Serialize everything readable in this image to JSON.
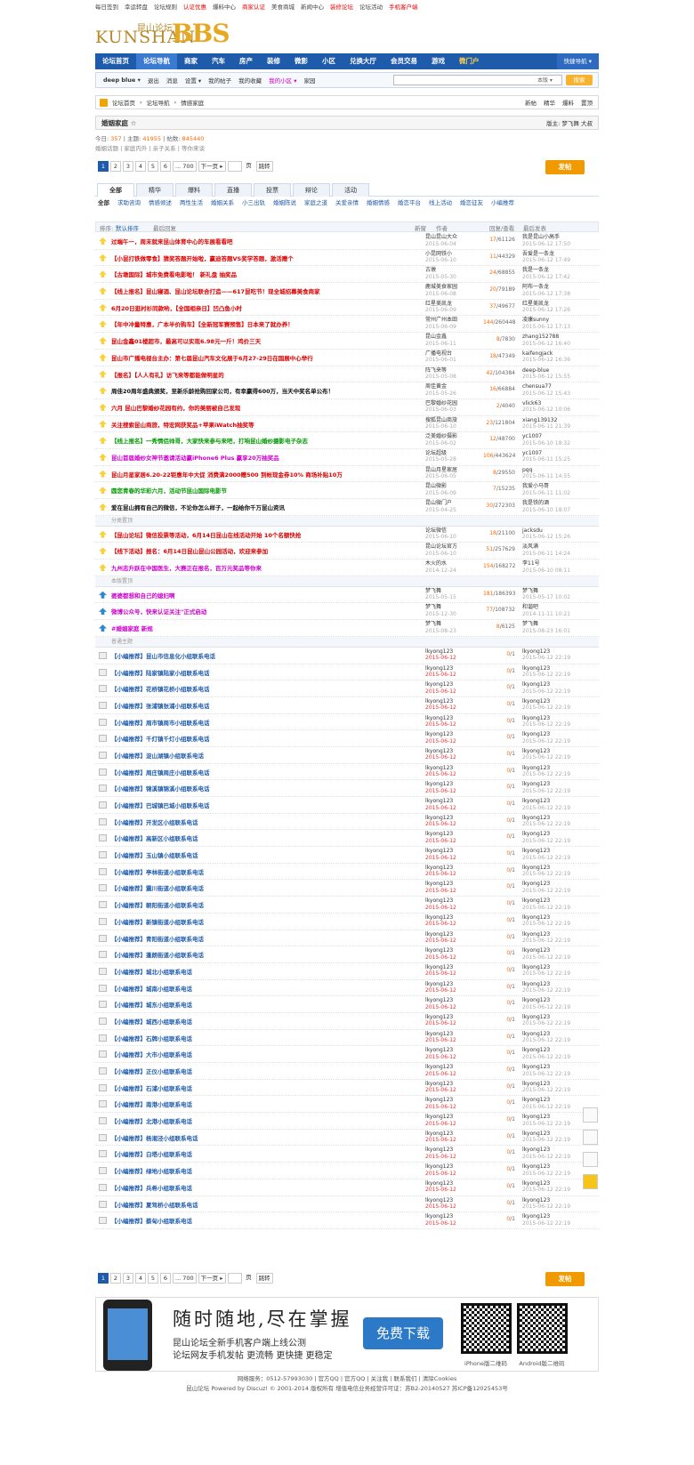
{
  "topbar": [
    "每日签到",
    "幸运转盘",
    "论坛规则",
    "认证优惠",
    "爆料中心",
    "商家认证",
    "美食商城",
    "新闻中心",
    "装修论坛",
    "论坛活动",
    "手机客户端"
  ],
  "logo": {
    "cn": "昆山论坛",
    "en": "KUNSHAN",
    "bbs": "BBS"
  },
  "nav": [
    "论坛首页",
    "论坛导航",
    "商家",
    "汽车",
    "房产",
    "装修",
    "微影",
    "小区",
    "兑换大厅",
    "会员交易",
    "游戏",
    "微门户"
  ],
  "nav_quick": "快捷导航 ▾",
  "subnav": [
    "deep blue ▾",
    "退出",
    "消息",
    "设置 ▾",
    "我的帖子",
    "我的收藏",
    "我的小区 ▾",
    "家园"
  ],
  "search_scope": "本版 ▾",
  "search_btn": "搜索",
  "crumb": [
    "论坛首页",
    "论坛导航",
    "情感家庭"
  ],
  "crumb_right": [
    "新帖",
    "精华",
    "爆料",
    "置顶"
  ],
  "forum": {
    "title": "婚姻家庭 ☆",
    "moderator": "版主: 梦飞舞 大叔"
  },
  "stats": {
    "today_l": "今日:",
    "today": "357",
    "topics_l": "主题:",
    "topics": "41955",
    "posts_l": "| 帖数:",
    "posts": "845440"
  },
  "stats2": "婚姻话题 | 家庭内外 | 亲子关系 | 等你来谈",
  "pages": [
    "1",
    "2",
    "3",
    "4",
    "5",
    "6",
    "... 700",
    "下一页 ▸"
  ],
  "pager_jump": "页",
  "pager_go": "跳转",
  "post_btn": "发帖",
  "tabs": [
    "全部",
    "精华",
    "爆料",
    "直播",
    "投票",
    "辩论",
    "活动"
  ],
  "filters": [
    "全部",
    "求助咨询",
    "情感倾述",
    "两性生活",
    "婚姻关系",
    "小三出轨",
    "婚姻陈说",
    "家庭之道",
    "关爱亲情",
    "婚姻情感",
    "婚恋平台",
    "线上活动",
    "婚恋征友",
    "小编推荐"
  ],
  "thead": {
    "sort": "排序:",
    "order1": "默认排序",
    "order2": "最后回复",
    "new": "新窗",
    "author": "作者",
    "reply": "回复/查看",
    "last": "最后发表"
  },
  "sec1": "分类置顶",
  "sec2": "本版置顶",
  "sec3": "普通主题",
  "rows": [
    {
      "title": "过端午一，周末就来昆山体育中心的车展看看吧",
      "color": "#d00",
      "author": "昆山昆山大众",
      "date": "2015-06-04",
      "reply": "17",
      "view": "61126",
      "last": "我是昆山小高手",
      "ldate": "2015-06-12 17:50"
    },
    {
      "title": "【小昆打铁做零食】猜奖答题开始啦，赢迪答题VS奖学答题，激活赠个",
      "color": "#d00",
      "author": "小昆网铁小",
      "date": "2015-06-10",
      "reply": "11",
      "view": "44329",
      "last": "吾爱是一条龙",
      "ldate": "2015-06-12 17:49"
    },
    {
      "title": "【古墩国际】城市免费看电影啦！ 新礼盘 抽奖品",
      "color": "#d00",
      "author": "古墩",
      "date": "2015-05-30",
      "reply": "24",
      "view": "68855",
      "last": "我是一条龙",
      "ldate": "2015-06-12 17:42"
    },
    {
      "title": "【线上报名】昆山寝酒、昆山论坛联合打造——617昆吃节！现全城招募美食商家",
      "color": "#d00",
      "author": "鹿城美食家园",
      "date": "2015-06-08",
      "reply": "20",
      "view": "79189",
      "last": "阿布一条龙",
      "ldate": "2015-06-12 17:38"
    },
    {
      "title": "6月20日逛衬衫同款哟，【全国相亲日】凹凸鱼小时",
      "color": "#d00",
      "author": "红星美凯龙",
      "date": "2015-06-09",
      "reply": "37",
      "view": "49677",
      "last": "红星美凯龙",
      "ldate": "2015-06-12 17:26"
    },
    {
      "title": "【年中冲量特惠，广本半价购车】【全新冠军赛预售】日本来了就办养！",
      "color": "#d00",
      "author": "常州广州本田",
      "date": "2015-06-09",
      "reply": "144",
      "view": "260448",
      "last": "凌康sunny",
      "ldate": "2015-06-12 17:13"
    },
    {
      "title": "昆山金鑫01楼超市，最高可以实现6.98元一斤！鸡价三天",
      "color": "#d00",
      "author": "昆山金鑫",
      "date": "2015-06-11",
      "reply": "8",
      "view": "7830",
      "last": "zhang152788",
      "ldate": "2015-06-12 16:40"
    },
    {
      "title": "昆山市广播电视台主办：第七届昆山汽车文化展于6月27-29日在国展中心举行",
      "color": "#d00",
      "author": "广播电视台",
      "date": "2015-06-01",
      "reply": "18",
      "view": "47349",
      "last": "kaifengjack",
      "ldate": "2015-06-12 16:36"
    },
    {
      "title": "【报名】【人人有礼】访飞来等都能做明星的",
      "color": "#d00",
      "author": "阵飞来等",
      "date": "2015-05-08",
      "reply": "42",
      "view": "104384",
      "last": "deep-blue",
      "ldate": "2015-06-12 15:55"
    },
    {
      "title": "周佳20周年盛典颁奖，至新乐龄抢购回家公司，有幸赢得600万，当天中奖名单公布！",
      "color": "#111",
      "author": "周佳黄金",
      "date": "2015-05-26",
      "reply": "16",
      "view": "66884",
      "last": "chensua77",
      "ldate": "2015-06-12 15:43"
    },
    {
      "title": "六月 昆山巴黎婚纱花园有约，你的美丽被自己发现",
      "color": "#d00",
      "author": "巴黎婚纱花园",
      "date": "2015-06-03",
      "reply": "2",
      "view": "4040",
      "last": "vlick63",
      "ldate": "2015-06-12 10:06"
    },
    {
      "title": "关注搜索昆山商旅，特宏网获奖品+苹果iWatch抽奖等",
      "color": "#d00",
      "author": "搜狐昆山商旅",
      "date": "2015-06-10",
      "reply": "23",
      "view": "121804",
      "last": "xiang139132",
      "ldate": "2015-06-11 21:39"
    },
    {
      "title": "【线上报名】一秀情侣帅哥，大家快来参与来吧，打响昆山婚纱摄影电子杂志",
      "color": "#090",
      "author": "泛美婚纱摄影",
      "date": "2015-06-02",
      "reply": "12",
      "view": "48700",
      "last": "yc1007",
      "ldate": "2015-06-10 18:32"
    },
    {
      "title": "昆山首届婚纱女神节邀请活动赢iPhone6 Plus 赢享20万抽奖品",
      "color": "#c0c",
      "author": "论坛超级",
      "date": "2015-05-28",
      "reply": "106",
      "view": "443624",
      "last": "yc1007",
      "ldate": "2015-06-11 15:25"
    },
    {
      "title": "昆山月星家居6.20-22钜惠年中大促 消费满2000赠500 到帐现金券10% 商场补贴10万",
      "color": "#d00",
      "author": "昆山月星家居",
      "date": "2015-06-05",
      "reply": "8",
      "view": "29550",
      "last": "pqq",
      "ldate": "2015-06-11 14:55"
    },
    {
      "title": "圆您青春的华彩六月，活动节昆山国际电影节",
      "color": "#090",
      "author": "昆山微影",
      "date": "2015-06-09",
      "reply": "7",
      "view": "15235",
      "last": "我爱小马哥",
      "ldate": "2015-06-11 11:02"
    },
    {
      "title": "爱在昆山拥有自己的微信，不论你怎么样子，一起给你千万昆山资讯",
      "color": "#111",
      "author": "昆山微门户",
      "date": "2015-04-25",
      "reply": "30",
      "view": "272303",
      "last": "我是铁的酒",
      "ldate": "2015-06-10 18:07"
    },
    {
      "sep": "sec1"
    },
    {
      "title": "【昆山论坛】微信投票等活动，6月14日昆山在线活动开始 10个名额快抢",
      "color": "#d00",
      "author": "论坛微信",
      "date": "2015-06-10",
      "reply": "18",
      "view": "21100",
      "last": "jacksdu",
      "ldate": "2015-06-12 15:26"
    },
    {
      "title": "【线下活动】报名：6月14日昆山昆山公园活动，欢迎来参加",
      "color": "#d00",
      "author": "昆山论坛官方",
      "date": "2015-06-10",
      "reply": "51",
      "view": "257629",
      "last": "淡风满",
      "ldate": "2015-06-11 14:24"
    },
    {
      "title": "九州志升跃在中国医生，大赛正在报名，百万元奖品等你来",
      "color": "#c0c",
      "author": "木火的水",
      "date": "2014-12-24",
      "reply": "154",
      "view": "168272",
      "last": "李11号",
      "ldate": "2015-06-10 08:11"
    },
    {
      "sep": "sec2"
    },
    {
      "title": "婆婆都想和自己的媳妇啊",
      "color": "#c0c",
      "author": "梦飞舞",
      "date": "2015-05-15",
      "reply": "181",
      "view": "186393",
      "last": "梦飞舞",
      "ldate": "2015-05-17 10:02"
    },
    {
      "title": "微博公众号，快来认证关注\"正式启动",
      "color": "#c0c",
      "author": "梦飞舞",
      "date": "2015-12-30",
      "reply": "77",
      "view": "108732",
      "last": "和谐吧",
      "ldate": "2014-11-11 10:21"
    },
    {
      "title": "#婚姻家庭 新规",
      "color": "#c0c",
      "author": "梦飞舞",
      "date": "2015-08-23",
      "reply": "8",
      "view": "6125",
      "last": "梦飞舞",
      "ldate": "2015-08-23 16:01"
    },
    {
      "sep": "sec3"
    },
    {
      "title": "【小编推荐】昆山市信息化小组联系电话",
      "color": "#1f5bab",
      "author": "lkyong123",
      "date": "2015-06-12",
      "reply": "0",
      "view": "1",
      "last": "lkyong123",
      "ldate": "2015-06-12 22:19"
    },
    {
      "title": "【小编推荐】陆家镇陆家小组联系电话",
      "color": "#1f5bab",
      "author": "lkyong123",
      "date": "2015-06-12",
      "reply": "0",
      "view": "1",
      "last": "lkyong123",
      "ldate": "2015-06-12 22:19"
    },
    {
      "title": "【小编推荐】花桥镇花桥小组联系电话",
      "color": "#1f5bab",
      "author": "lkyong123",
      "date": "2015-06-12",
      "reply": "0",
      "view": "1",
      "last": "lkyong123",
      "ldate": "2015-06-12 22:19"
    },
    {
      "title": "【小编推荐】张浦镇张浦小组联系电话",
      "color": "#1f5bab",
      "author": "lkyong123",
      "date": "2015-06-12",
      "reply": "0",
      "view": "1",
      "last": "lkyong123",
      "ldate": "2015-06-12 22:19"
    },
    {
      "title": "【小编推荐】周市镇周市小组联系电话",
      "color": "#1f5bab",
      "author": "lkyong123",
      "date": "2015-06-12",
      "reply": "0",
      "view": "1",
      "last": "lkyong123",
      "ldate": "2015-06-12 22:19"
    },
    {
      "title": "【小编推荐】千灯镇千灯小组联系电话",
      "color": "#1f5bab",
      "author": "lkyong123",
      "date": "2015-06-12",
      "reply": "0",
      "view": "1",
      "last": "lkyong123",
      "ldate": "2015-06-12 22:19"
    },
    {
      "title": "【小编推荐】淀山湖镇小组联系电话",
      "color": "#1f5bab",
      "author": "lkyong123",
      "date": "2015-06-12",
      "reply": "0",
      "view": "1",
      "last": "lkyong123",
      "ldate": "2015-06-12 22:19"
    },
    {
      "title": "【小编推荐】周庄镇周庄小组联系电话",
      "color": "#1f5bab",
      "author": "lkyong123",
      "date": "2015-06-12",
      "reply": "0",
      "view": "1",
      "last": "lkyong123",
      "ldate": "2015-06-12 22:19"
    },
    {
      "title": "【小编推荐】锦溪镇锦溪小组联系电话",
      "color": "#1f5bab",
      "author": "lkyong123",
      "date": "2015-06-12",
      "reply": "0",
      "view": "1",
      "last": "lkyong123",
      "ldate": "2015-06-12 22:19"
    },
    {
      "title": "【小编推荐】巴城镇巴城小组联系电话",
      "color": "#1f5bab",
      "author": "lkyong123",
      "date": "2015-06-12",
      "reply": "0",
      "view": "1",
      "last": "lkyong123",
      "ldate": "2015-06-12 22:19"
    },
    {
      "title": "【小编推荐】开发区小组联系电话",
      "color": "#1f5bab",
      "author": "lkyong123",
      "date": "2015-06-12",
      "reply": "0",
      "view": "1",
      "last": "lkyong123",
      "ldate": "2015-06-12 22:19"
    },
    {
      "title": "【小编推荐】高新区小组联系电话",
      "color": "#1f5bab",
      "author": "lkyong123",
      "date": "2015-06-12",
      "reply": "0",
      "view": "1",
      "last": "lkyong123",
      "ldate": "2015-06-12 22:19"
    },
    {
      "title": "【小编推荐】玉山镇小组联系电话",
      "color": "#1f5bab",
      "author": "lkyong123",
      "date": "2015-06-12",
      "reply": "0",
      "view": "1",
      "last": "lkyong123",
      "ldate": "2015-06-12 22:19"
    },
    {
      "title": "【小编推荐】亭林街道小组联系电话",
      "color": "#1f5bab",
      "author": "lkyong123",
      "date": "2015-06-12",
      "reply": "0",
      "view": "1",
      "last": "lkyong123",
      "ldate": "2015-06-12 22:19"
    },
    {
      "title": "【小编推荐】震川街道小组联系电话",
      "color": "#1f5bab",
      "author": "lkyong123",
      "date": "2015-06-12",
      "reply": "0",
      "view": "1",
      "last": "lkyong123",
      "ldate": "2015-06-12 22:19"
    },
    {
      "title": "【小编推荐】朝阳街道小组联系电话",
      "color": "#1f5bab",
      "author": "lkyong123",
      "date": "2015-06-12",
      "reply": "0",
      "view": "1",
      "last": "lkyong123",
      "ldate": "2015-06-12 22:19"
    },
    {
      "title": "【小编推荐】新镇街道小组联系电话",
      "color": "#1f5bab",
      "author": "lkyong123",
      "date": "2015-06-12",
      "reply": "0",
      "view": "1",
      "last": "lkyong123",
      "ldate": "2015-06-12 22:19"
    },
    {
      "title": "【小编推荐】青阳街道小组联系电话",
      "color": "#1f5bab",
      "author": "lkyong123",
      "date": "2015-06-12",
      "reply": "0",
      "view": "1",
      "last": "lkyong123",
      "ldate": "2015-06-12 22:19"
    },
    {
      "title": "【小编推荐】蓬朗街道小组联系电话",
      "color": "#1f5bab",
      "author": "lkyong123",
      "date": "2015-06-12",
      "reply": "0",
      "view": "1",
      "last": "lkyong123",
      "ldate": "2015-06-12 22:19"
    },
    {
      "title": "【小编推荐】城北小组联系电话",
      "color": "#1f5bab",
      "author": "lkyong123",
      "date": "2015-06-12",
      "reply": "0",
      "view": "1",
      "last": "lkyong123",
      "ldate": "2015-06-12 22:19"
    },
    {
      "title": "【小编推荐】城南小组联系电话",
      "color": "#1f5bab",
      "author": "lkyong123",
      "date": "2015-06-12",
      "reply": "0",
      "view": "1",
      "last": "lkyong123",
      "ldate": "2015-06-12 22:19"
    },
    {
      "title": "【小编推荐】城东小组联系电话",
      "color": "#1f5bab",
      "author": "lkyong123",
      "date": "2015-06-12",
      "reply": "0",
      "view": "1",
      "last": "lkyong123",
      "ldate": "2015-06-12 22:19"
    },
    {
      "title": "【小编推荐】城西小组联系电话",
      "color": "#1f5bab",
      "author": "lkyong123",
      "date": "2015-06-12",
      "reply": "0",
      "view": "1",
      "last": "lkyong123",
      "ldate": "2015-06-12 22:19"
    },
    {
      "title": "【小编推荐】石牌小组联系电话",
      "color": "#1f5bab",
      "author": "lkyong123",
      "date": "2015-06-12",
      "reply": "0",
      "view": "1",
      "last": "lkyong123",
      "ldate": "2015-06-12 22:19"
    },
    {
      "title": "【小编推荐】大市小组联系电话",
      "color": "#1f5bab",
      "author": "lkyong123",
      "date": "2015-06-12",
      "reply": "0",
      "view": "1",
      "last": "lkyong123",
      "ldate": "2015-06-12 22:19"
    },
    {
      "title": "【小编推荐】正仪小组联系电话",
      "color": "#1f5bab",
      "author": "lkyong123",
      "date": "2015-06-12",
      "reply": "0",
      "view": "1",
      "last": "lkyong123",
      "ldate": "2015-06-12 22:19"
    },
    {
      "title": "【小编推荐】石浦小组联系电话",
      "color": "#1f5bab",
      "author": "lkyong123",
      "date": "2015-06-12",
      "reply": "0",
      "view": "1",
      "last": "lkyong123",
      "ldate": "2015-06-12 22:19"
    },
    {
      "title": "【小编推荐】南港小组联系电话",
      "color": "#1f5bab",
      "author": "lkyong123",
      "date": "2015-06-12",
      "reply": "0",
      "view": "1",
      "last": "lkyong123",
      "ldate": "2015-06-12 22:19"
    },
    {
      "title": "【小编推荐】北港小组联系电话",
      "color": "#1f5bab",
      "author": "lkyong123",
      "date": "2015-06-12",
      "reply": "0",
      "view": "1",
      "last": "lkyong123",
      "ldate": "2015-06-12 22:19"
    },
    {
      "title": "【小编推荐】杨湘泾小组联系电话",
      "color": "#1f5bab",
      "author": "lkyong123",
      "date": "2015-06-12",
      "reply": "0",
      "view": "1",
      "last": "lkyong123",
      "ldate": "2015-06-12 22:19"
    },
    {
      "title": "【小编推荐】白塔小组联系电话",
      "color": "#1f5bab",
      "author": "lkyong123",
      "date": "2015-06-12",
      "reply": "0",
      "view": "1",
      "last": "lkyong123",
      "ldate": "2015-06-12 22:19"
    },
    {
      "title": "【小编推荐】绿地小组联系电话",
      "color": "#1f5bab",
      "author": "lkyong123",
      "date": "2015-06-12",
      "reply": "0",
      "view": "1",
      "last": "lkyong123",
      "ldate": "2015-06-12 22:19"
    },
    {
      "title": "【小编推荐】兵希小组联系电话",
      "color": "#1f5bab",
      "author": "lkyong123",
      "date": "2015-06-12",
      "reply": "0",
      "view": "1",
      "last": "lkyong123",
      "ldate": "2015-06-12 22:19"
    },
    {
      "title": "【小编推荐】夏驾桥小组联系电话",
      "color": "#1f5bab",
      "author": "lkyong123",
      "date": "2015-06-12",
      "reply": "0",
      "view": "1",
      "last": "lkyong123",
      "ldate": "2015-06-12 22:19"
    },
    {
      "title": "【小编推荐】蔡甸小组联系电话",
      "color": "#1f5bab",
      "author": "lkyong123",
      "date": "2015-06-12",
      "reply": "0",
      "view": "1",
      "last": "lkyong123",
      "ldate": "2015-06-12 22:19"
    }
  ],
  "app": {
    "slogan": "随时随地,尽在掌握",
    "t1": "昆山论坛全新手机客户端上线公测",
    "t2": "论坛网友手机发帖 更流畅 更快捷 更稳定",
    "download": "免费下载",
    "qr1": "iPhone版二维码",
    "qr2": "Android版二维码"
  },
  "foot": "网络服务：0512-57993030 | 官方QQ | 官方QQ | 关注我 | 联系我们 | 清除Cookies",
  "foot2": "昆山论坛 Powered by Discuz! © 2001-2014 版权所有 增值电信业务经营许可证：苏B2-20140527 苏ICP备12025453号",
  "colors": {
    "nav": "#1f5bab",
    "accent": "#f09a00"
  }
}
